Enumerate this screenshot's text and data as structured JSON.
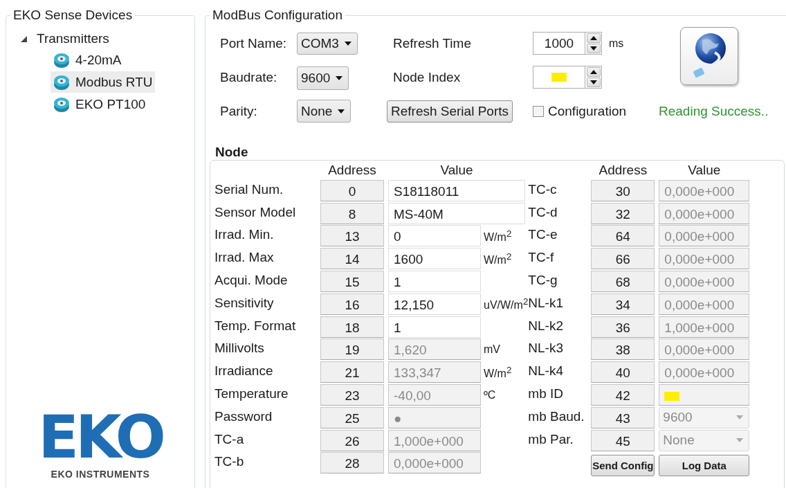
{
  "devices_panel": {
    "title": "EKO Sense Devices",
    "tree": [
      {
        "label": "Transmitters",
        "expanded": true,
        "children": [
          {
            "label": "4-20mA",
            "selected": false
          },
          {
            "label": "Modbus RTU",
            "selected": true
          },
          {
            "label": "EKO PT100",
            "selected": false
          }
        ]
      }
    ],
    "logo": {
      "wordmark": "EKO",
      "caption": "EKO INSTRUMENTS"
    }
  },
  "modbus": {
    "title": "ModBus Configuration",
    "port_name": {
      "label": "Port Name:",
      "value": "COM3"
    },
    "baudrate": {
      "label": "Baudrate:",
      "value": "9600"
    },
    "parity": {
      "label": "Parity:",
      "value": "None"
    },
    "refresh_time": {
      "label": "Refresh Time",
      "value": "1000",
      "unit": "ms"
    },
    "node_index": {
      "label": "Node Index",
      "masked": true
    },
    "refresh_ports_button": "Refresh Serial Ports",
    "configuration": {
      "label": "Configuration",
      "checked": false
    },
    "status": "Reading Success..",
    "node": {
      "title": "Node",
      "left": {
        "columns": [
          "Address",
          "Value"
        ],
        "rows": [
          {
            "label": "Serial Num.",
            "address": "0",
            "value": "S18118011",
            "kind": "wide"
          },
          {
            "label": "Sensor Model",
            "address": "8",
            "value": "MS-40M",
            "kind": "wide"
          },
          {
            "label": "Irrad. Min.",
            "address": "13",
            "value": "0",
            "kind": "edit",
            "unit": "W/m$^{2}$"
          },
          {
            "label": "Irrad. Max",
            "address": "14",
            "value": "1600",
            "kind": "edit",
            "unit": "W/m$^{2}$"
          },
          {
            "label": "Acqui. Mode",
            "address": "15",
            "value": "1",
            "kind": "edit"
          },
          {
            "label": "Sensitivity",
            "address": "16",
            "value": "12,150",
            "kind": "edit",
            "unit": "uV/W/m$^{2}$"
          },
          {
            "label": "Temp. Format",
            "address": "18",
            "value": "1",
            "kind": "edit"
          },
          {
            "label": "Millivolts",
            "address": "19",
            "value": "1,620",
            "kind": "readonly",
            "unit": "mV"
          },
          {
            "label": "Irradiance",
            "address": "21",
            "value": "133,347",
            "kind": "readonly",
            "unit": "W/m$^{2}$"
          },
          {
            "label": "Temperature",
            "address": "23",
            "value": "-40,00",
            "kind": "readonly",
            "unit": "ºC"
          },
          {
            "label": "Password",
            "address": "25",
            "value": "●",
            "kind": "readonly"
          },
          {
            "label": "TC-a",
            "address": "26",
            "value": "1,000e+000",
            "kind": "readonly"
          },
          {
            "label": "TC-b",
            "address": "28",
            "value": "0,000e+000",
            "kind": "readonly"
          }
        ]
      },
      "right": {
        "columns": [
          "Address",
          "Value"
        ],
        "rows": [
          {
            "label": "TC-c",
            "address": "30",
            "value": "0,000e+000",
            "kind": "readonly"
          },
          {
            "label": "TC-d",
            "address": "32",
            "value": "0,000e+000",
            "kind": "readonly"
          },
          {
            "label": "TC-e",
            "address": "64",
            "value": "0,000e+000",
            "kind": "readonly"
          },
          {
            "label": "TC-f",
            "address": "66",
            "value": "0,000e+000",
            "kind": "readonly"
          },
          {
            "label": "TC-g",
            "address": "68",
            "value": "0,000e+000",
            "kind": "readonly"
          },
          {
            "label": "NL-k1",
            "address": "34",
            "value": "0,000e+000",
            "kind": "readonly"
          },
          {
            "label": "NL-k2",
            "address": "36",
            "value": "1,000e+000",
            "kind": "readonly"
          },
          {
            "label": "NL-k3",
            "address": "38",
            "value": "0,000e+000",
            "kind": "readonly"
          },
          {
            "label": "NL-k4",
            "address": "40",
            "value": "0,000e+000",
            "kind": "readonly"
          },
          {
            "label": "mb ID",
            "address": "42",
            "kind": "masked"
          },
          {
            "label": "mb Baud.",
            "address": "43",
            "value": "9600",
            "kind": "dropdown"
          },
          {
            "label": "mb Par.",
            "address": "45",
            "value": "None",
            "kind": "dropdown"
          }
        ]
      },
      "buttons": [
        "Send Config",
        "Log Data"
      ]
    }
  }
}
